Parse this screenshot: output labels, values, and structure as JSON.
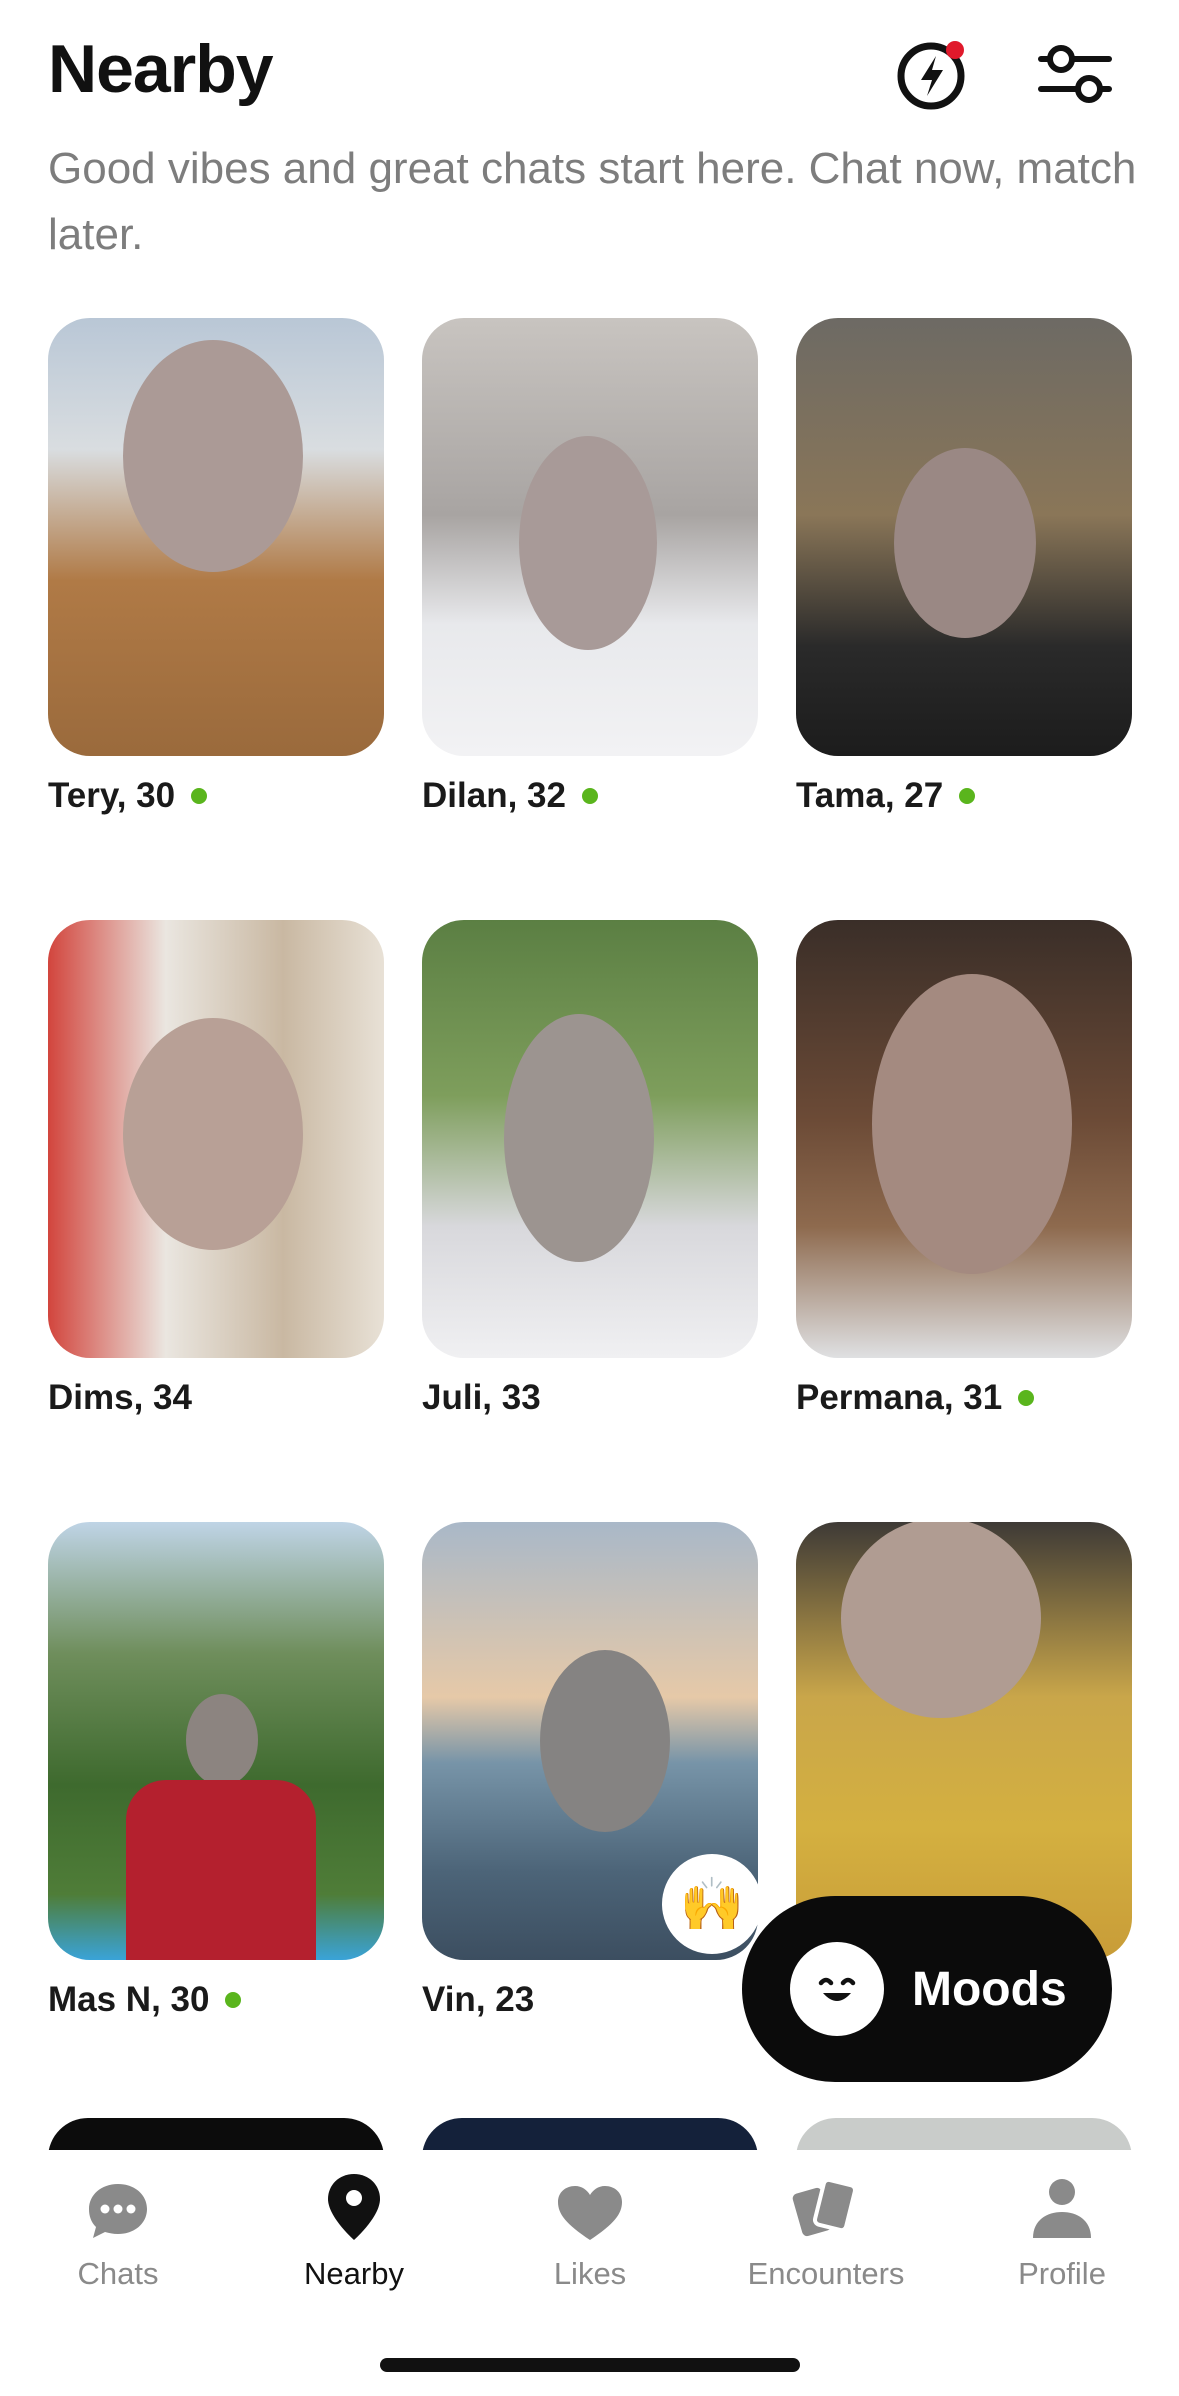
{
  "header": {
    "title": "Nearby",
    "subtitle": "Good vibes and great chats start here. Chat now, match later.",
    "boost_icon": "lightning-bolt-icon",
    "filter_icon": "sliders-icon"
  },
  "profiles": [
    {
      "name": "Tery, 30",
      "online": true
    },
    {
      "name": "Dilan, 32",
      "online": true
    },
    {
      "name": "Tama, 27",
      "online": true
    },
    {
      "name": "Dims, 34",
      "online": false
    },
    {
      "name": "Juli, 33",
      "online": false
    },
    {
      "name": "Permana, 31",
      "online": true
    },
    {
      "name": "Mas N, 30",
      "online": true
    },
    {
      "name": "Vin, 23",
      "online": false,
      "badge": "🙌"
    },
    {
      "name": "",
      "online": false
    }
  ],
  "moods": {
    "label": "Moods",
    "icon": "smiley-face-icon"
  },
  "tabs": [
    {
      "label": "Chats",
      "icon": "chat-bubble-icon",
      "active": false
    },
    {
      "label": "Nearby",
      "icon": "location-pin-icon",
      "active": true
    },
    {
      "label": "Likes",
      "icon": "heart-icon",
      "active": false
    },
    {
      "label": "Encounters",
      "icon": "cards-icon",
      "active": false
    },
    {
      "label": "Profile",
      "icon": "person-icon",
      "active": false
    }
  ],
  "colors": {
    "online": "#5ab51d",
    "notification_dot": "#e0192b",
    "active_tab": "#111111",
    "inactive_tab": "#8a8a8a"
  }
}
